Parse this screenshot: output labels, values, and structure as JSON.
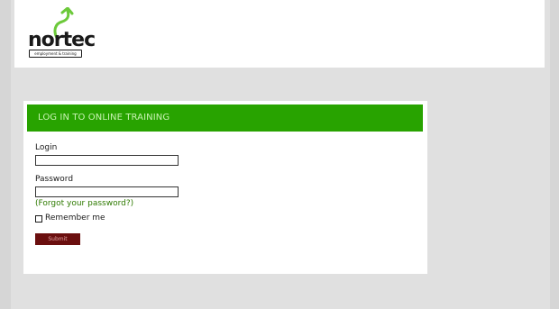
{
  "brand": {
    "logo_text": "nortec",
    "logo_tagline": "employment & training",
    "accent_green": "#28a300",
    "arrow_green": "#6cc93a"
  },
  "login_panel": {
    "title": "LOG IN TO ONLINE TRAINING",
    "login_label": "Login",
    "login_value": "",
    "password_label": "Password",
    "password_value": "",
    "forgot_link": "(Forgot your password?)",
    "remember_label": "Remember me",
    "remember_checked": false,
    "submit_label": "Submit"
  }
}
